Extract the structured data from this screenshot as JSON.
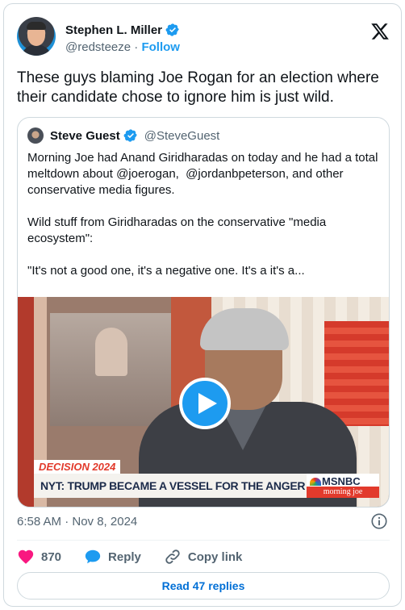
{
  "author": {
    "name": "Stephen L. Miller",
    "handle": "@redsteeze",
    "separator": "·",
    "follow_label": "Follow"
  },
  "tweet": {
    "text": "These guys blaming Joe Rogan for an election where their candidate chose to ignore him is just wild."
  },
  "quoted": {
    "name": "Steve Guest",
    "handle": "@SteveGuest",
    "paragraphs": [
      "Morning Joe had Anand Giridharadas on today and he had a total meltdown about @joerogan,  @jordanbpeterson, and other conservative media figures.",
      "Wild stuff from Giridharadas on the conservative \"media ecosystem\":",
      "\"It's not a good one, it's a negative one. It's a it's a..."
    ],
    "video": {
      "chyron_top": "DECISION 2024",
      "chyron": "NYT: TRUMP BECAME A VESSEL FOR THE ANGER OF MILLIONS",
      "network": "MSNBC",
      "show": "morning joe"
    }
  },
  "meta": {
    "timestamp": "6:58 AM · Nov 8, 2024"
  },
  "actions": {
    "likes": "870",
    "reply_label": "Reply",
    "copy_label": "Copy link",
    "read_replies_label": "Read 47 replies"
  },
  "colors": {
    "accent": "#1d9bf0",
    "like": "#f91880",
    "text": "#0f1419",
    "muted": "#536471"
  },
  "icons": [
    "verified-badge-icon",
    "x-logo-icon",
    "play-icon",
    "heart-icon",
    "reply-bubble-icon",
    "link-icon",
    "info-icon"
  ]
}
